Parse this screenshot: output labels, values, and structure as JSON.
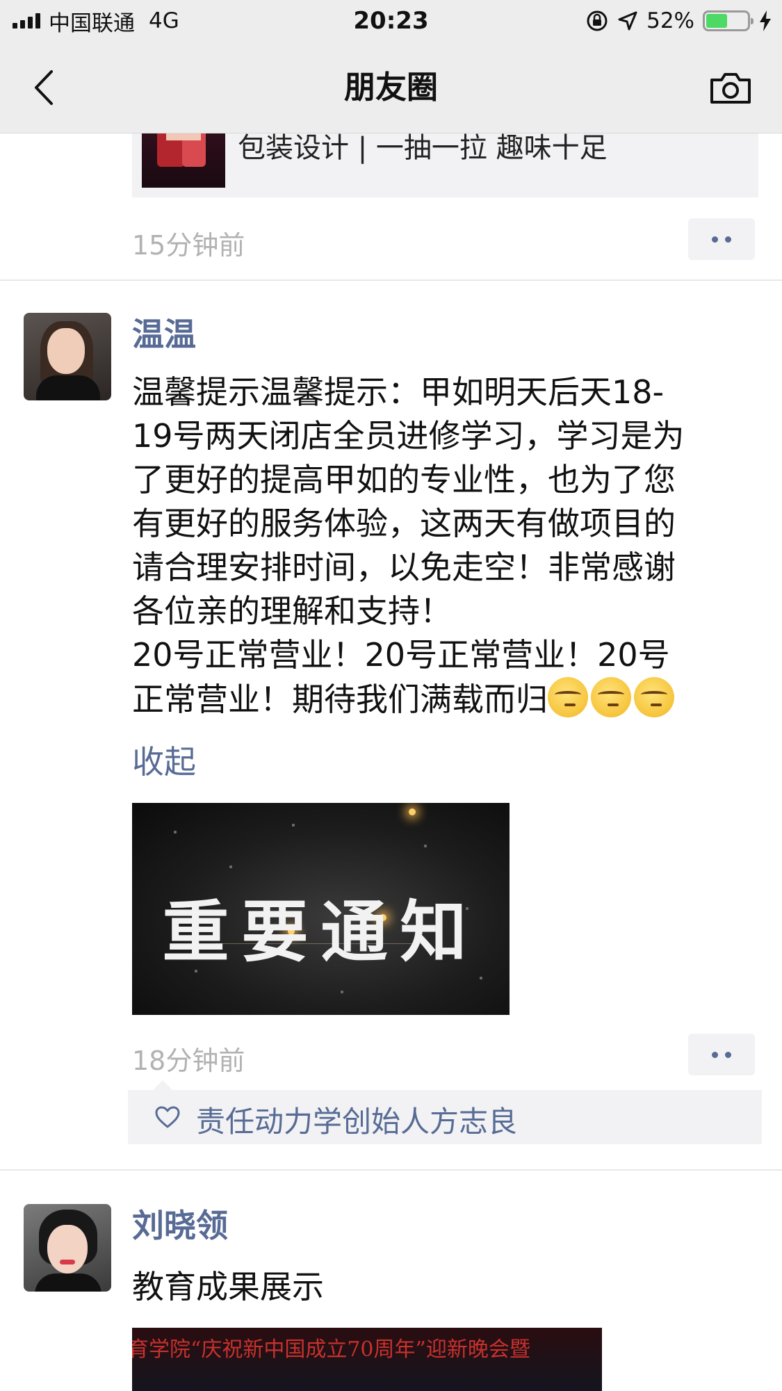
{
  "status_bar": {
    "carrier": "中国联通",
    "network": "4G",
    "time": "20:23",
    "battery_percent": "52%",
    "battery_level": 0.52
  },
  "nav": {
    "title": "朋友圈"
  },
  "feed": {
    "previous_post": {
      "link_title": "包装设计 | 一抽一拉 趣味十足",
      "time": "15分钟前"
    },
    "post": {
      "username": "温温",
      "text_lines": [
        "温馨提示温馨提示：甲如明天后天18-",
        "19号两天闭店全员进修学习，学习是为",
        "了更好的提高甲如的专业性，也为了您",
        "有更好的服务体验，这两天有做项目的",
        "请合理安排时间，以免走空！非常感谢",
        "各位亲的理解和支持！",
        "20号正常营业！20号正常营业！20号",
        "正常营业！期待我们满载而归"
      ],
      "collapse_label": "收起",
      "image_text": "重要通知",
      "time": "18分钟前",
      "likes": [
        "责任动力学创始人方志良"
      ]
    },
    "next_post": {
      "username": "刘晓领",
      "text": "教育成果展示",
      "video_caption": "育学院“庆祝新中国成立70周年”迎新晚会暨"
    }
  },
  "colors": {
    "link_blue": "#576b95",
    "time_gray": "#b2b2b2",
    "nav_bg": "#ededed"
  }
}
